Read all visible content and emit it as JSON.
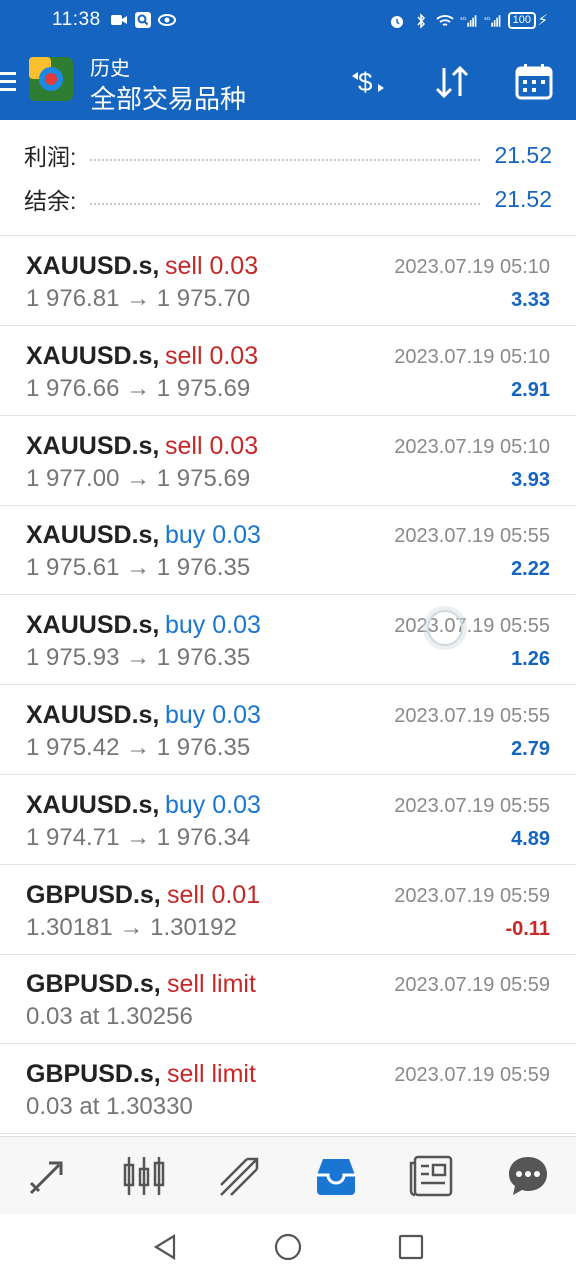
{
  "status_bar": {
    "time": "11:38",
    "battery": "100",
    "network_labels": [
      "4G",
      "4G"
    ]
  },
  "app_bar": {
    "subtitle": "历史",
    "title": "全部交易品种",
    "accent_color": "#1565c0"
  },
  "summary": {
    "profit_label": "利润:",
    "profit_value": "21.52",
    "balance_label": "结余:",
    "balance_value": "21.52"
  },
  "trades": [
    {
      "symbol": "XAUUSD.s,",
      "direction": "sell 0.03",
      "type": "sell",
      "prices": "1 976.81 → 1 975.70",
      "time": "2023.07.19 05:10",
      "profit": "3.33",
      "sign": "pos"
    },
    {
      "symbol": "XAUUSD.s,",
      "direction": "sell 0.03",
      "type": "sell",
      "prices": "1 976.66 → 1 975.69",
      "time": "2023.07.19 05:10",
      "profit": "2.91",
      "sign": "pos"
    },
    {
      "symbol": "XAUUSD.s,",
      "direction": "sell 0.03",
      "type": "sell",
      "prices": "1 977.00 → 1 975.69",
      "time": "2023.07.19 05:10",
      "profit": "3.93",
      "sign": "pos"
    },
    {
      "symbol": "XAUUSD.s,",
      "direction": "buy 0.03",
      "type": "buy",
      "prices": "1 975.61 → 1 976.35",
      "time": "2023.07.19 05:55",
      "profit": "2.22",
      "sign": "pos"
    },
    {
      "symbol": "XAUUSD.s,",
      "direction": "buy 0.03",
      "type": "buy",
      "prices": "1 975.93 → 1 976.35",
      "time": "2023.07.19 05:55",
      "profit": "1.26",
      "sign": "pos"
    },
    {
      "symbol": "XAUUSD.s,",
      "direction": "buy 0.03",
      "type": "buy",
      "prices": "1 975.42 → 1 976.35",
      "time": "2023.07.19 05:55",
      "profit": "2.79",
      "sign": "pos"
    },
    {
      "symbol": "XAUUSD.s,",
      "direction": "buy 0.03",
      "type": "buy",
      "prices": "1 974.71 → 1 976.34",
      "time": "2023.07.19 05:55",
      "profit": "4.89",
      "sign": "pos"
    },
    {
      "symbol": "GBPUSD.s,",
      "direction": "sell 0.01",
      "type": "sell",
      "prices": "1.30181 → 1.30192",
      "time": "2023.07.19 05:59",
      "profit": "-0.11",
      "sign": "neg"
    },
    {
      "symbol": "GBPUSD.s,",
      "direction": "sell limit",
      "type": "sell",
      "prices": "0.03 at 1.30256",
      "time": "2023.07.19 05:59",
      "profit": "",
      "sign": "pos"
    },
    {
      "symbol": "GBPUSD.s,",
      "direction": "sell limit",
      "type": "sell",
      "prices": "0.03 at 1.30330",
      "time": "2023.07.19 05:59",
      "profit": "",
      "sign": "pos"
    }
  ],
  "bottom_nav": [
    {
      "name": "quotes-icon",
      "active": false
    },
    {
      "name": "chart-icon",
      "active": false
    },
    {
      "name": "trade-icon",
      "active": false
    },
    {
      "name": "history-icon",
      "active": true
    },
    {
      "name": "news-icon",
      "active": false
    },
    {
      "name": "chat-icon",
      "active": false
    }
  ]
}
